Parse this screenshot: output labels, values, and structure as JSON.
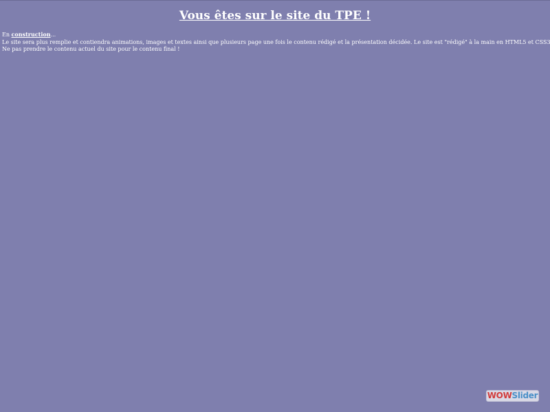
{
  "header": {
    "title": "Vous êtes sur le site du TPE !"
  },
  "intro": {
    "line1_prefix": "En ",
    "line1_emphasis": "construction",
    "line1_suffix": "...",
    "line2": "Le site sera plus remplie et contiendra animations, images et textes ainsi que plusieurs page une fois le contenu rédigé et la présentation décidée. Le site est \"rédigé\" à la main en HTML5 et CSS3.",
    "line3": "Ne pas prendre le contenu actuel du site pour le contenu final !"
  },
  "logo": {
    "part1": "WOW",
    "part2": "Slider"
  },
  "colors": {
    "background": "#7f7fae",
    "text": "#ffffff",
    "logo_wow": "#d23b3b",
    "logo_slider": "#4a90c8"
  }
}
